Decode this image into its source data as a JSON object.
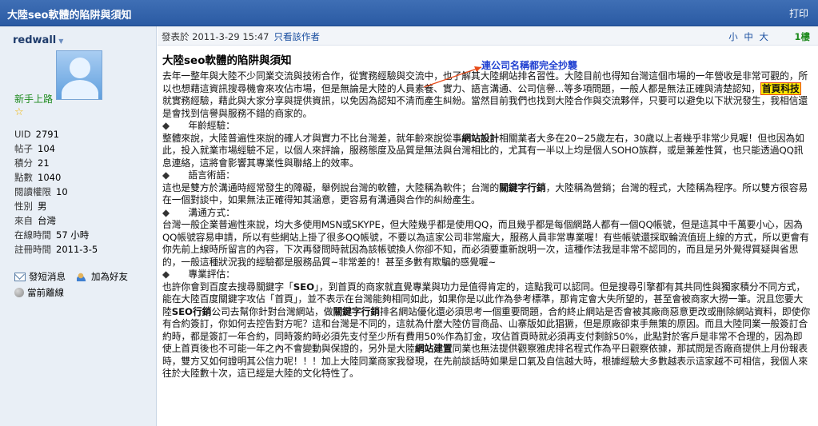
{
  "window": {
    "title": "大陸seo軟體的陷阱與須知",
    "print_label": "打印"
  },
  "sidebar": {
    "username": "redwall",
    "rank": "新手上路",
    "stats": [
      {
        "label": "UID",
        "value": "2791"
      },
      {
        "label": "帖子",
        "value": "104"
      },
      {
        "label": "積分",
        "value": "21"
      },
      {
        "label": "點數",
        "value": "1040"
      },
      {
        "label": "閱讀權限",
        "value": "10"
      },
      {
        "label": "性別",
        "value": "男"
      },
      {
        "label": "來自",
        "value": "台灣"
      },
      {
        "label": "在線時間",
        "value": "57 小時"
      },
      {
        "label": "註冊時間",
        "value": "2011-3-5"
      }
    ],
    "actions": {
      "send_message": "發短消息",
      "add_friend": "加為好友",
      "status": "當前離線"
    }
  },
  "post": {
    "meta": "發表於 2011-3-29 15:47",
    "author_only": "只看該作者",
    "font_small": "小",
    "font_medium": "中",
    "font_large": "大",
    "floor": "1樓",
    "title": "大陸seo軟體的陷阱與須知",
    "annotation": "連公司名稱都完全抄襲",
    "highlighted_company": "首頁科技",
    "p1a": "去年一整年與大陸不少同業交流與技術合作，從實務經驗與交流中，也了解其大陸網站排名習性。大陸目前也得知台灣這個市場的一年營收是非常可觀的，所以也想藉這資訊搜尋機會來攻佔市場，但是無論是大陸的人員素養、實力、語言溝通、公司信譽...等多項問題，一般人都是無法正確與清楚認知，",
    "p1b": "就實務經驗，藉此與大家分享與提供資訊，以免因為認知不清而產生糾紛。當然目前我們也找到大陸合作與交流夥伴，只要可以避免以下狀況發生，我相信還是會找到信譽與服務不錯的商家的。",
    "h_age": "年齡經驗：",
    "p2a": "整體來說，大陸普遍性來說的確人才與實力不比台灣差，就年齡來說從事",
    "p2b": "網站設計",
    "p2c": "相關業者大多在20~25歲左右，30歲以上者幾乎非常少見喔！但也因為如此，投入就業市場經驗不足，以個人來評論，服務態度及品質是無法與台灣相比的，尤其有一半以上均是個人SOHO族群，或是兼差性質，也只能透過QQ訊息連絡，這將會影響其專業性與聯絡上的效率。",
    "h_lang": "語言術語：",
    "p3a": "這也是雙方於溝通時經常發生的障礙，舉例說台灣的軟體，大陸稱為軟件；台灣的",
    "p3b": "關鍵字行銷",
    "p3c": "，大陸稱為營銷；台灣的程式，大陸稱為程序。所以雙方很容易在一個對談中，如果無法正確得知其涵意，更容易有溝通與合作的糾紛產生。",
    "h_comm": "溝通方式：",
    "p4": "台灣一般企業普遍性來說，均大多使用MSN或SKYPE，但大陸幾乎都是使用QQ，而且幾乎都是每個網路人都有一個QQ帳號，但是這其中千萬要小心，因為QQ帳號容易申請，所以有些網站上掛了很多QQ帳號，不要以為這家公司非常龐大，服務人員非常專業喔！有些帳號還採取輪流值班上線的方式，所以更會有你先前上線時所留言的內容，下次再發問時就因為該帳號換人你卻不知，而必須要重新說明一次，這種作法我是非常不認同的，而且是另外覺得質疑與省思的，一般這種狀況我的經驗都是服務品質~非常差的！甚至多數有欺騙的感覺喔~",
    "h_eval": "專業評估：",
    "p5a": "也許你會到百度去搜尋關鍵字「",
    "p5b": "SEO",
    "p5c": "」，到首頁的商家就直覺專業與功力是值得肯定的，這點我可以認同。但是搜尋引擎都有其共同性與獨家積分不同方式，能在大陸百度關鍵字攻佔「首頁」，並不表示在台灣能夠相同如此，如果你是以此作為參考標準，那肯定會大失所望的，甚至會被商家大撈一筆。況且您要大陸",
    "p5d": "SEO行銷",
    "p5e": "公司去幫你針對台灣網站，做",
    "p5f": "關鍵字行銷",
    "p5g": "排名網站優化還必須思考一個重要問題，合約終止網站是否會被其廠商惡意更改或刪除網站資料，即使你有合約簽訂，你如何去控告對方呢？這和台灣是不同的，這就為什麼大陸仿冒商品、山寨版如此猖獗，但是原廠卻束手無策的原因。而且大陸同業一般簽訂合約時，都是簽訂一年合約，同時簽約時必須先支付至少所有費用50%作為訂金，攻佔首頁時就必須再支付剩餘50%，此點對於客戶是非常不合理的，因為即使上首頁後也不可能一年之內不會變動與保證的，另外是大陸",
    "p5h": "網站建置",
    "p5i": "同業也無法提供觀察雅虎排名程式作為平日觀察依據，那試問是否廠商提供上月份報表時，雙方又如何證明其公信力呢！！！加上大陸同業商家我發現，在先前談話時如果是口氣及自信越大時，根據經驗大多數越表示這家越不可相信，我個人來往於大陸數十次，這已經是大陸的文化特性了。"
  },
  "colors": {
    "titlebar": "#2f62ab",
    "annotation": "#1f3fd0",
    "highlight_fill": "#ffe600",
    "highlight_border": "#e74c1a",
    "rank": "#1d8a1d"
  }
}
